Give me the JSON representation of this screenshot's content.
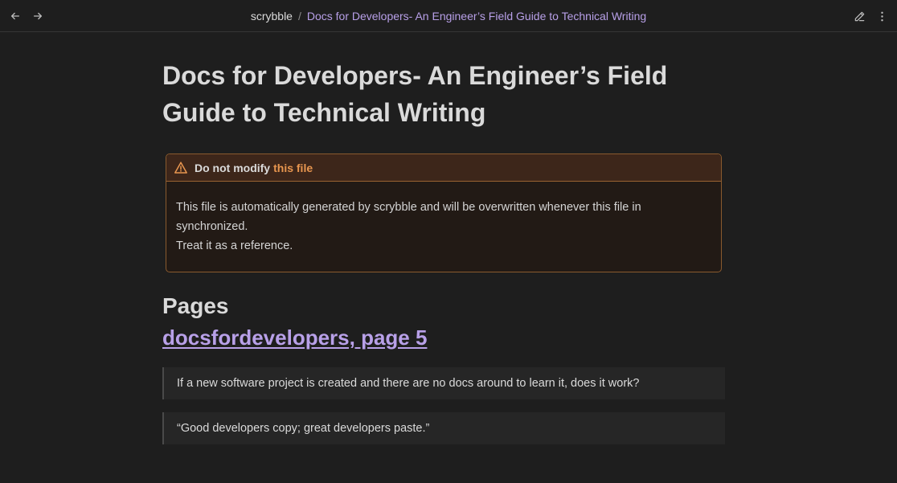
{
  "titlebar": {
    "back_icon": "arrow-left-icon",
    "forward_icon": "arrow-right-icon",
    "breadcrumb_parent": "scrybble",
    "breadcrumb_separator": "/",
    "breadcrumb_current": "Docs for Developers- An Engineer’s Field Guide to Technical Writing",
    "edit_icon": "pencil-icon",
    "more_icon": "more-vertical-icon"
  },
  "document": {
    "title": "Docs for Developers- An Engineer’s Field Guide to Technical Writing",
    "callout": {
      "icon": "warning-triangle-icon",
      "title": "Do not modify",
      "title_link": "this file",
      "body_line1": "This file is automatically generated by scrybble and will be overwritten whenever this file in synchronized.",
      "body_line2": "Treat it as a reference."
    },
    "pages_heading": "Pages",
    "page_link": "docsfordevelopers, page 5",
    "quotes": [
      "If a new software project is created and there are no docs around to learn it, does it work?",
      "“Good developers copy; great developers paste.”"
    ]
  },
  "colors": {
    "background": "#1e1e1e",
    "accent": "#b8a0e8",
    "warning": "#e8964f"
  }
}
